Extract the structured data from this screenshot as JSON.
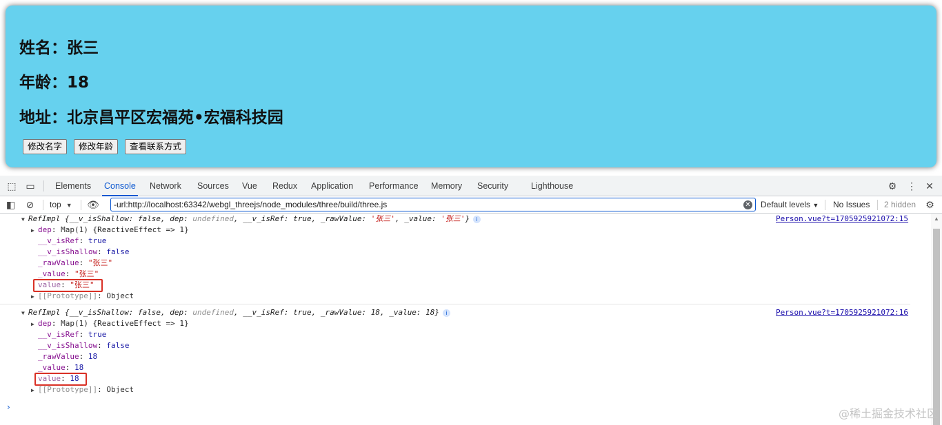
{
  "page": {
    "name_line": "姓名：张三",
    "age_line": "年龄：18",
    "address_line": "地址：北京昌平区宏福苑•宏福科技园",
    "buttons": [
      "修改名字",
      "修改年龄",
      "查看联系方式"
    ],
    "card_color": "#66d1ee"
  },
  "devtools": {
    "tabs": [
      "Elements",
      "Console",
      "Network",
      "Sources",
      "Vue",
      "Redux",
      "Application",
      "Performance",
      "Memory",
      "Security",
      "Lighthouse"
    ],
    "active_tab": "Console",
    "context": "top",
    "filter_value": "-url:http://localhost:63342/webgl_threejs/node_modules/three/build/three.js",
    "levels": "Default levels",
    "issues": "No Issues",
    "hidden": "2 hidden"
  },
  "log": {
    "entry1": {
      "header_class": "RefImpl",
      "header_a": " {__v_isShallow: false, dep: ",
      "header_undef": "undefined",
      "header_b": ", __v_isRef: true, _rawValue: ",
      "header_raw": "'张三'",
      "header_c": ", _value: ",
      "header_val": "'张三'",
      "header_d": "}",
      "source": "Person.vue?t=1705925921072:15",
      "dep_key": "dep",
      "dep_val": "Map(1)",
      "dep_rest": " {ReactiveEffect => 1}",
      "isref_key": "__v_isRef",
      "isref_val": "true",
      "isshallow_key": "__v_isShallow",
      "isshallow_val": "false",
      "raw_key": "_rawValue",
      "raw_val": "\"张三\"",
      "priv_key": "_value",
      "priv_val": "\"张三\"",
      "value_key": "value",
      "value_val": "\"张三\"",
      "proto_key": "[[Prototype]]",
      "proto_val": "Object"
    },
    "entry2": {
      "header_class": "RefImpl",
      "header_a": " {__v_isShallow: false, dep: ",
      "header_undef": "undefined",
      "header_b": ", __v_isRef: true, _rawValue: 18, _value: 18}",
      "source": "Person.vue?t=1705925921072:16",
      "dep_key": "dep",
      "dep_val": "Map(1)",
      "dep_rest": " {ReactiveEffect => 1}",
      "isref_key": "__v_isRef",
      "isref_val": "true",
      "isshallow_key": "__v_isShallow",
      "isshallow_val": "false",
      "raw_key": "_rawValue",
      "raw_val": "18",
      "priv_key": "_value",
      "priv_val": "18",
      "value_key": "value",
      "value_val": "18",
      "proto_key": "[[Prototype]]",
      "proto_val": "Object"
    },
    "prompt": "›"
  },
  "watermark": "@稀土掘金技术社区"
}
